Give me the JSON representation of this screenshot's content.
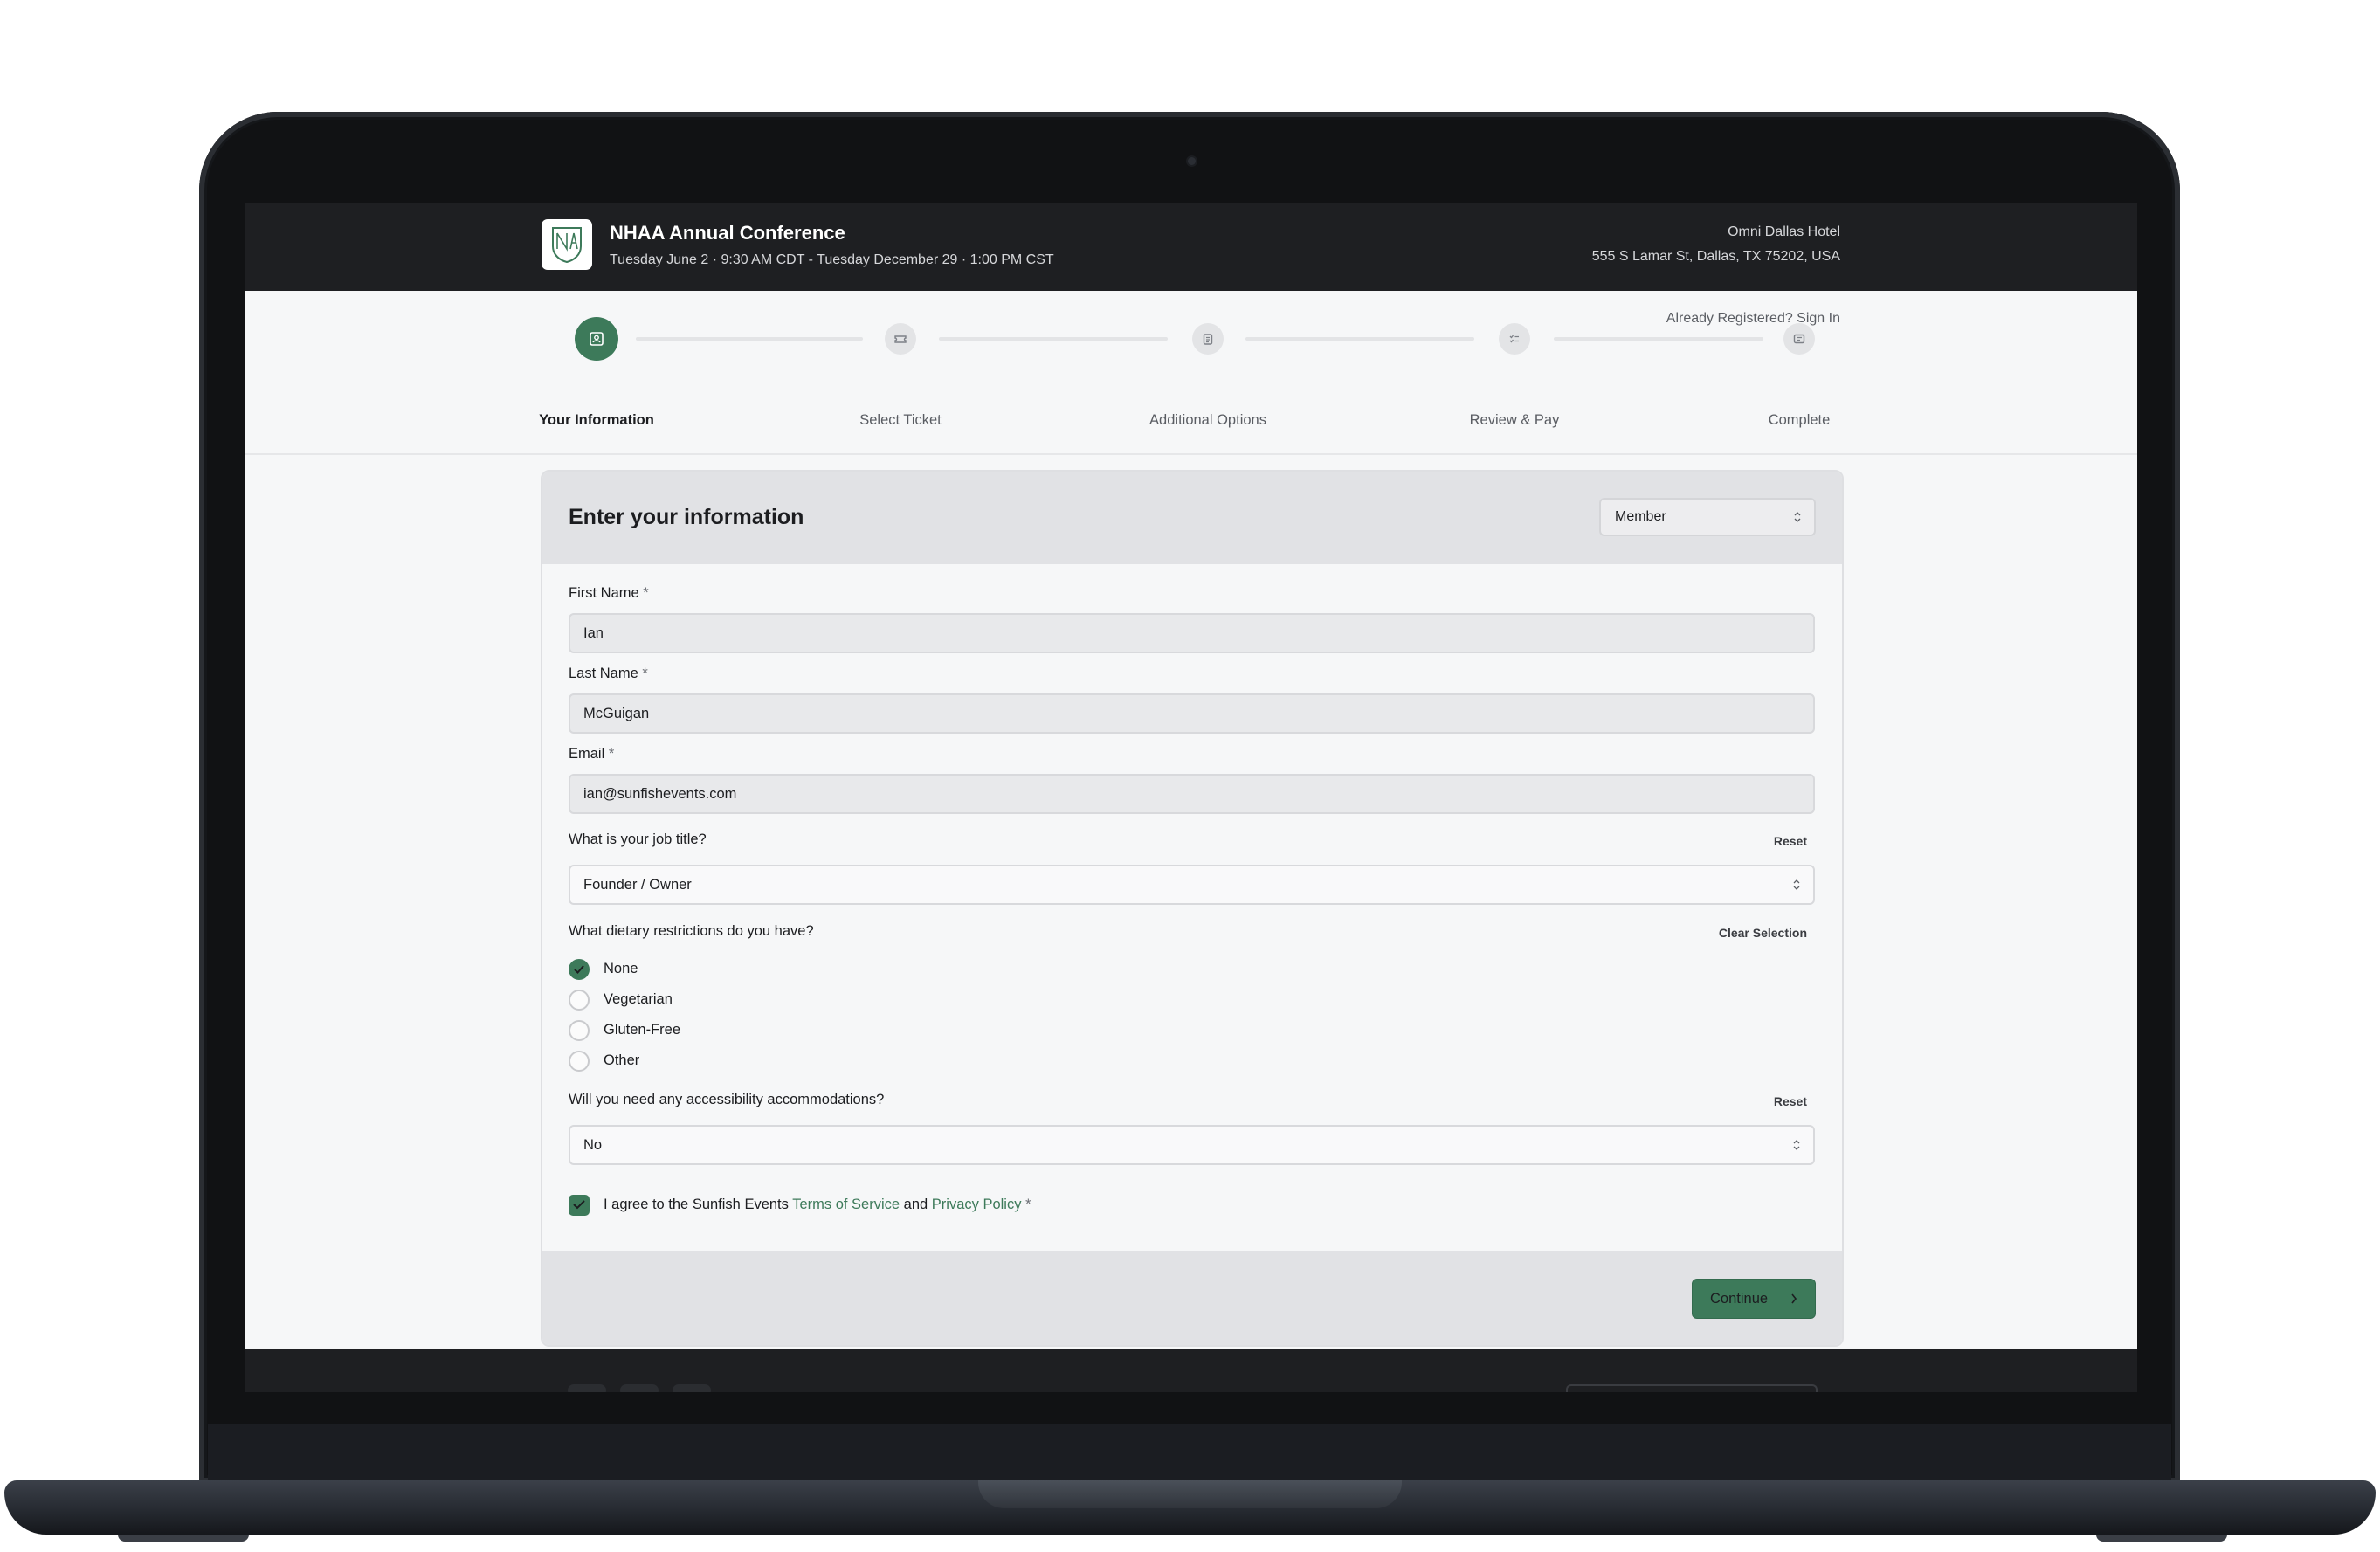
{
  "event": {
    "title": "NHAA Annual Conference",
    "date_range": "Tuesday June 2 · 9:30 AM CDT - Tuesday December 29 · 1:00 PM CST",
    "venue_name": "Omni Dallas Hotel",
    "venue_address": "555 S Lamar St, Dallas, TX 75202, USA"
  },
  "auth": {
    "signin_text": "Already Registered? Sign In"
  },
  "steps": [
    {
      "label": "Your Information",
      "icon": "id-card-icon",
      "active": true
    },
    {
      "label": "Select Ticket",
      "icon": "ticket-icon",
      "active": false
    },
    {
      "label": "Additional Options",
      "icon": "clipboard-icon",
      "active": false
    },
    {
      "label": "Review & Pay",
      "icon": "checklist-icon",
      "active": false
    },
    {
      "label": "Complete",
      "icon": "receipt-icon",
      "active": false
    }
  ],
  "form": {
    "title": "Enter your information",
    "attendee_type": "Member",
    "fields": {
      "first_name": {
        "label": "First Name",
        "required_mark": "*",
        "value": "Ian"
      },
      "last_name": {
        "label": "Last Name",
        "required_mark": "*",
        "value": "McGuigan"
      },
      "email": {
        "label": "Email",
        "required_mark": "*",
        "value": "ian@sunfishevents.com"
      }
    },
    "job_title": {
      "question": "What is your job title?",
      "reset": "Reset",
      "value": "Founder / Owner"
    },
    "dietary": {
      "question": "What dietary restrictions do you have?",
      "clear": "Clear Selection",
      "options": [
        "None",
        "Vegetarian",
        "Gluten-Free",
        "Other"
      ],
      "selected": "None"
    },
    "accessibility": {
      "question": "Will you need any accessibility accommodations?",
      "reset": "Reset",
      "value": "No"
    },
    "agreement": {
      "prefix": "I agree to the Sunfish Events",
      "terms": "Terms of Service",
      "and": "and",
      "privacy": "Privacy Policy",
      "required_mark": "*",
      "checked": true
    },
    "continue_label": "Continue"
  },
  "colors": {
    "accent": "#3d7a5a",
    "topbar": "#1e1f22"
  }
}
